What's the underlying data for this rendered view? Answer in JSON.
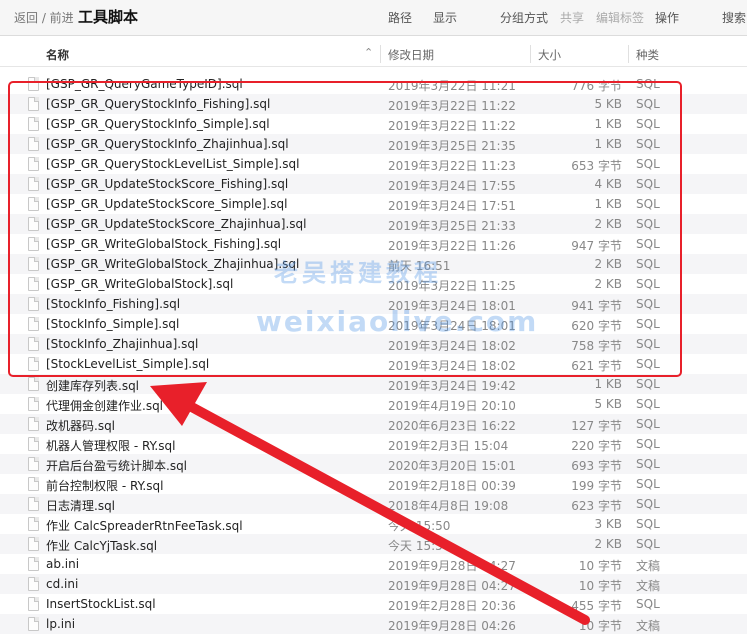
{
  "toolbar": {
    "nav": "返回 / 前进",
    "title": "工具脚本",
    "path": "路径",
    "show": "显示",
    "group": "分组方式",
    "share": "共享",
    "tags": "编辑标签",
    "ops": "操作",
    "search": "搜索"
  },
  "header": {
    "name": "名称",
    "date": "修改日期",
    "size": "大小",
    "kind": "种类"
  },
  "files": [
    {
      "name": "[GSP_GR_QueryGameTypeID].sql",
      "date": "2019年3月22日 11:21",
      "size": "776 字节",
      "kind": "SQL"
    },
    {
      "name": "[GSP_GR_QueryStockInfo_Fishing].sql",
      "date": "2019年3月22日 11:22",
      "size": "5 KB",
      "kind": "SQL"
    },
    {
      "name": "[GSP_GR_QueryStockInfo_Simple].sql",
      "date": "2019年3月22日 11:22",
      "size": "1 KB",
      "kind": "SQL"
    },
    {
      "name": "[GSP_GR_QueryStockInfo_Zhajinhua].sql",
      "date": "2019年3月25日 21:35",
      "size": "1 KB",
      "kind": "SQL"
    },
    {
      "name": "[GSP_GR_QueryStockLevelList_Simple].sql",
      "date": "2019年3月22日 11:23",
      "size": "653 字节",
      "kind": "SQL"
    },
    {
      "name": "[GSP_GR_UpdateStockScore_Fishing].sql",
      "date": "2019年3月24日 17:55",
      "size": "4 KB",
      "kind": "SQL"
    },
    {
      "name": "[GSP_GR_UpdateStockScore_Simple].sql",
      "date": "2019年3月24日 17:51",
      "size": "1 KB",
      "kind": "SQL"
    },
    {
      "name": "[GSP_GR_UpdateStockScore_Zhajinhua].sql",
      "date": "2019年3月25日 21:33",
      "size": "2 KB",
      "kind": "SQL"
    },
    {
      "name": "[GSP_GR_WriteGlobalStock_Fishing].sql",
      "date": "2019年3月22日 11:26",
      "size": "947 字节",
      "kind": "SQL"
    },
    {
      "name": "[GSP_GR_WriteGlobalStock_Zhajinhua].sql",
      "date": "前天 16:51",
      "size": "2 KB",
      "kind": "SQL"
    },
    {
      "name": "[GSP_GR_WriteGlobalStock].sql",
      "date": "2019年3月22日 11:25",
      "size": "2 KB",
      "kind": "SQL"
    },
    {
      "name": "[StockInfo_Fishing].sql",
      "date": "2019年3月24日 18:01",
      "size": "941 字节",
      "kind": "SQL"
    },
    {
      "name": "[StockInfo_Simple].sql",
      "date": "2019年3月24日 18:01",
      "size": "620 字节",
      "kind": "SQL"
    },
    {
      "name": "[StockInfo_Zhajinhua].sql",
      "date": "2019年3月24日 18:02",
      "size": "758 字节",
      "kind": "SQL"
    },
    {
      "name": "[StockLevelList_Simple].sql",
      "date": "2019年3月24日 18:02",
      "size": "621 字节",
      "kind": "SQL"
    },
    {
      "name": "创建库存列表.sql",
      "date": "2019年3月24日 19:42",
      "size": "1 KB",
      "kind": "SQL"
    },
    {
      "name": "代理佣金创建作业.sql",
      "date": "2019年4月19日 20:10",
      "size": "5 KB",
      "kind": "SQL"
    },
    {
      "name": "改机器码.sql",
      "date": "2020年6月23日 16:22",
      "size": "127 字节",
      "kind": "SQL"
    },
    {
      "name": "机器人管理权限 - RY.sql",
      "date": "2019年2月3日 15:04",
      "size": "220 字节",
      "kind": "SQL"
    },
    {
      "name": "开启后台盈亏统计脚本.sql",
      "date": "2020年3月20日 15:01",
      "size": "693 字节",
      "kind": "SQL"
    },
    {
      "name": "前台控制权限 - RY.sql",
      "date": "2019年2月18日 00:39",
      "size": "199 字节",
      "kind": "SQL"
    },
    {
      "name": "日志清理.sql",
      "date": "2018年4月8日 19:08",
      "size": "623 字节",
      "kind": "SQL"
    },
    {
      "name": "作业 CalcSpreaderRtnFeeTask.sql",
      "date": "今天 15:50",
      "size": "3 KB",
      "kind": "SQL"
    },
    {
      "name": "作业 CalcYjTask.sql",
      "date": "今天 15:50",
      "size": "2 KB",
      "kind": "SQL"
    },
    {
      "name": "ab.ini",
      "date": "2019年9月28日 04:27",
      "size": "10 字节",
      "kind": "文稿"
    },
    {
      "name": "cd.ini",
      "date": "2019年9月28日 04:27",
      "size": "10 字节",
      "kind": "文稿"
    },
    {
      "name": "InsertStockList.sql",
      "date": "2019年2月28日 20:36",
      "size": "455 字节",
      "kind": "SQL"
    },
    {
      "name": "lp.ini",
      "date": "2019年9月28日 04:26",
      "size": "10 字节",
      "kind": "文稿"
    }
  ],
  "watermark": {
    "line1": "老吴搭建教程",
    "line2": "weixiaolive.com"
  },
  "colors": {
    "highlight": "#e8202a",
    "watermark": "#5096e6",
    "arrow": "#e8202a"
  }
}
